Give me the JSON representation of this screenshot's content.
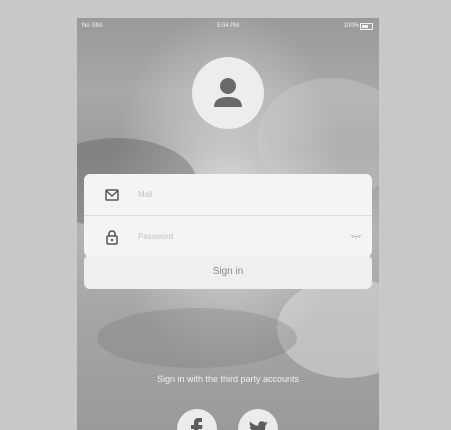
{
  "status_bar": {
    "carrier": "No SIM",
    "time": "5:04 PM",
    "battery": "100%"
  },
  "login": {
    "mail_placeholder": "Mail",
    "password_placeholder": "Password",
    "signin_label": "Sign in"
  },
  "third_party": {
    "label": "Sign in with the third party accounts",
    "providers": [
      "facebook",
      "twitter"
    ]
  },
  "icons": {
    "avatar": "user-icon",
    "mail": "mail-icon",
    "password": "lock-icon",
    "password_toggle": "eye-closed-icon",
    "facebook": "facebook-icon",
    "twitter": "twitter-icon"
  },
  "colors": {
    "background_frame": "#c8c8c8",
    "card": "#f4f4f4",
    "icon_dark": "#6a6a6a"
  }
}
